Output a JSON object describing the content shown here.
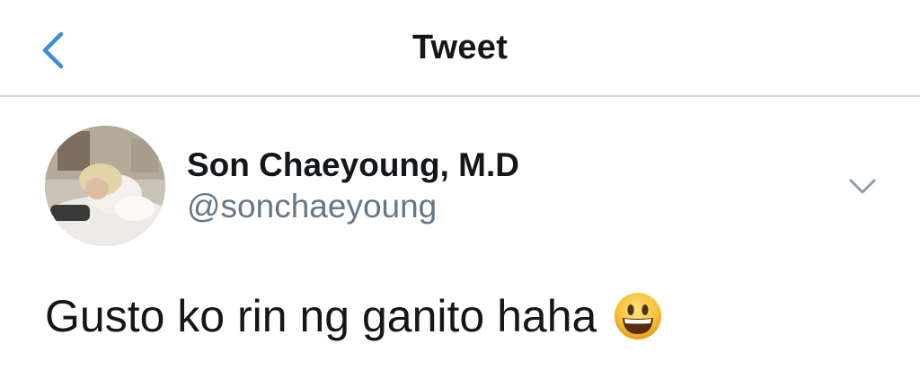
{
  "nav": {
    "title": "Tweet",
    "back_icon": "chevron-left-icon",
    "accent_color": "#1da1f2"
  },
  "tweet": {
    "author": {
      "display_name": "Son Chaeyoung, M.D",
      "handle": "@sonchaeyoung",
      "avatar": "profile-photo"
    },
    "more_icon": "chevron-down-icon",
    "text": "Gusto ko rin ng ganito haha",
    "emoji": "grinning-face-icon"
  },
  "colors": {
    "text_primary": "#14171a",
    "text_secondary": "#657786",
    "divider": "#d6d6d6"
  }
}
